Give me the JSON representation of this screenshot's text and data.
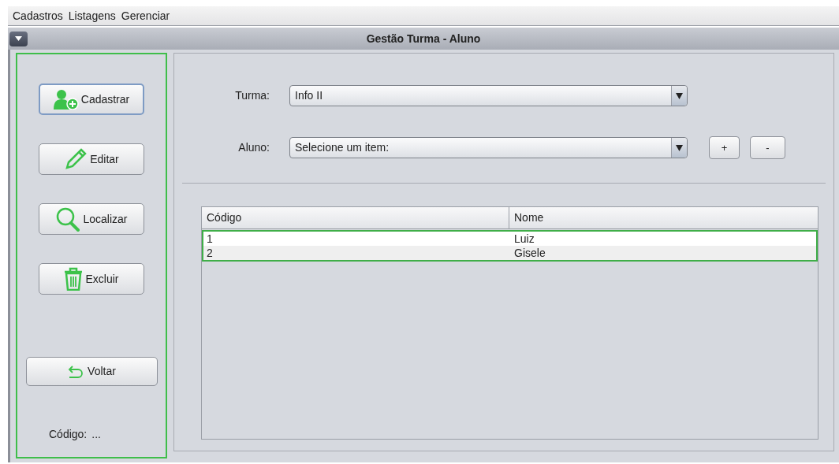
{
  "menu": [
    "Cadastros",
    "Listagens",
    "Gerenciar"
  ],
  "window": {
    "title": "Gestão Turma - Aluno"
  },
  "actions": [
    {
      "kind": "add-user",
      "label": "Cadastrar",
      "focused": true
    },
    {
      "kind": "pencil",
      "label": "Editar",
      "focused": false
    },
    {
      "kind": "search",
      "label": "Localizar",
      "focused": false
    },
    {
      "kind": "trash",
      "label": "Excluir",
      "focused": false
    }
  ],
  "back_button": {
    "label": "Voltar"
  },
  "code_label": "Código:",
  "code_value": "...",
  "turma": {
    "label": "Turma:",
    "value": "Info II"
  },
  "aluno": {
    "label": "Aluno:",
    "value": "Selecione um item:"
  },
  "add_button": "+",
  "remove_button": "-",
  "table": {
    "columns": [
      "Código",
      "Nome"
    ],
    "rows": [
      {
        "cells": [
          "1",
          "Luiz"
        ]
      },
      {
        "cells": [
          "2",
          "Gisele"
        ]
      }
    ]
  }
}
